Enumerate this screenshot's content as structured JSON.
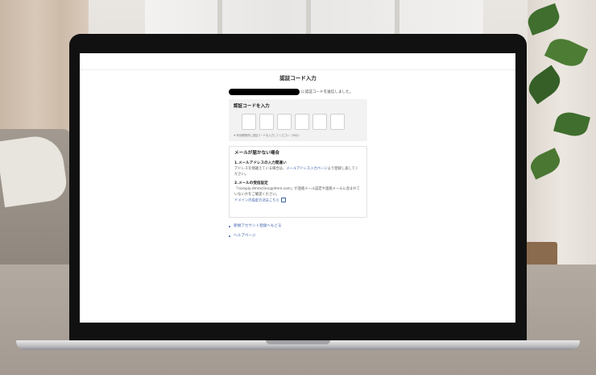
{
  "page": {
    "title": "認証コード入力",
    "sent_message": "に認証コードを送信しました。"
  },
  "code_entry": {
    "title": "認証コードを入力",
    "digit_count": 6,
    "note": "※ 有効期限内に認証コードを入力してください（30分）"
  },
  "help": {
    "title": "メールが届かない場合",
    "section1_heading": "1.メールアドレスの入力間違い",
    "section1_text_before": "アドレスを間違えている場合は、",
    "section1_link": "メールアドレス入力ページ",
    "section1_text_after": "より登録し直してください。",
    "section2_heading": "2.メールの受信設定",
    "section2_text": "「noreply-dmmclinic@dmm.com」が迷惑メール設定や迷惑メールに含まれていないかをご確認ください。",
    "section2_link": "ドメインの設定方法はこちら"
  },
  "links": [
    {
      "label": "新規アカウント登録へもどる"
    },
    {
      "label": "ヘルプページ"
    }
  ],
  "colors": {
    "link": "#3b5ea8",
    "card_bg": "#f2f2f2",
    "bezel": "#111111"
  },
  "icons": {
    "external_link": "external-link-icon",
    "bullet": "bullet-icon"
  }
}
